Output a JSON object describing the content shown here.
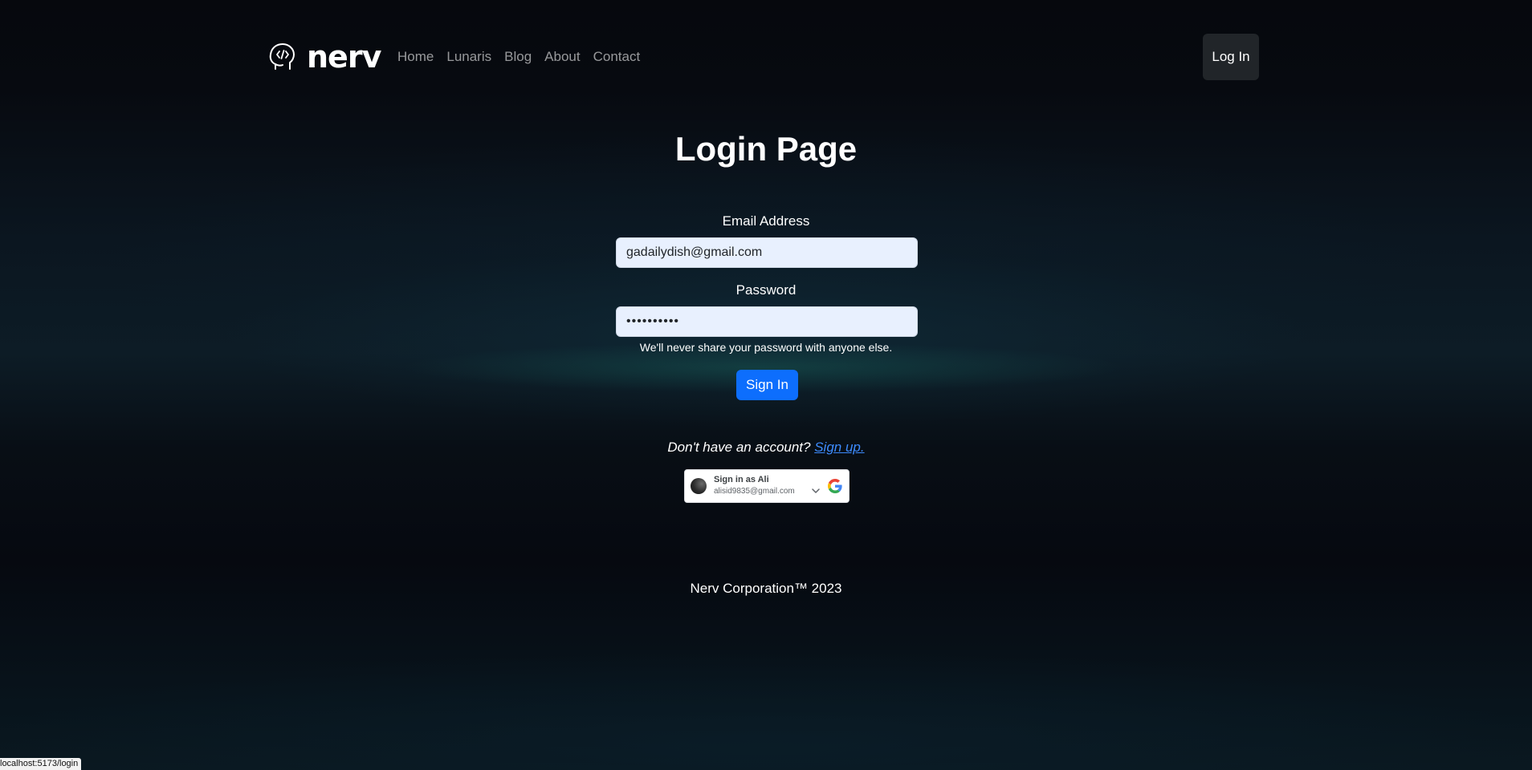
{
  "header": {
    "brand": "nerv",
    "nav": [
      {
        "label": "Home"
      },
      {
        "label": "Lunaris"
      },
      {
        "label": "Blog"
      },
      {
        "label": "About"
      },
      {
        "label": "Contact"
      }
    ],
    "login_label": "Log In"
  },
  "main": {
    "title": "Login Page",
    "email": {
      "label": "Email Address",
      "value": "gadailydish@gmail.com"
    },
    "password": {
      "label": "Password",
      "value": "••••••••••",
      "help": "We'll never share your password with anyone else."
    },
    "submit_label": "Sign In",
    "signup_prompt": "Don't have an account?",
    "signup_link": "Sign up."
  },
  "google": {
    "signin_as": "Sign in as Ali",
    "email": "alisid9835@gmail.com"
  },
  "footer": {
    "text": "Nerv Corporation™ 2023"
  },
  "status_bar": {
    "url": "localhost:5173/login"
  },
  "colors": {
    "primary": "#0d6efd",
    "link": "#3d8bfd",
    "dark_button": "#212529",
    "input_bg": "#e8f0fe"
  },
  "icons": {
    "brand": "brain-code-icon",
    "google": "google-logo-icon",
    "dropdown": "chevron-down-icon"
  }
}
